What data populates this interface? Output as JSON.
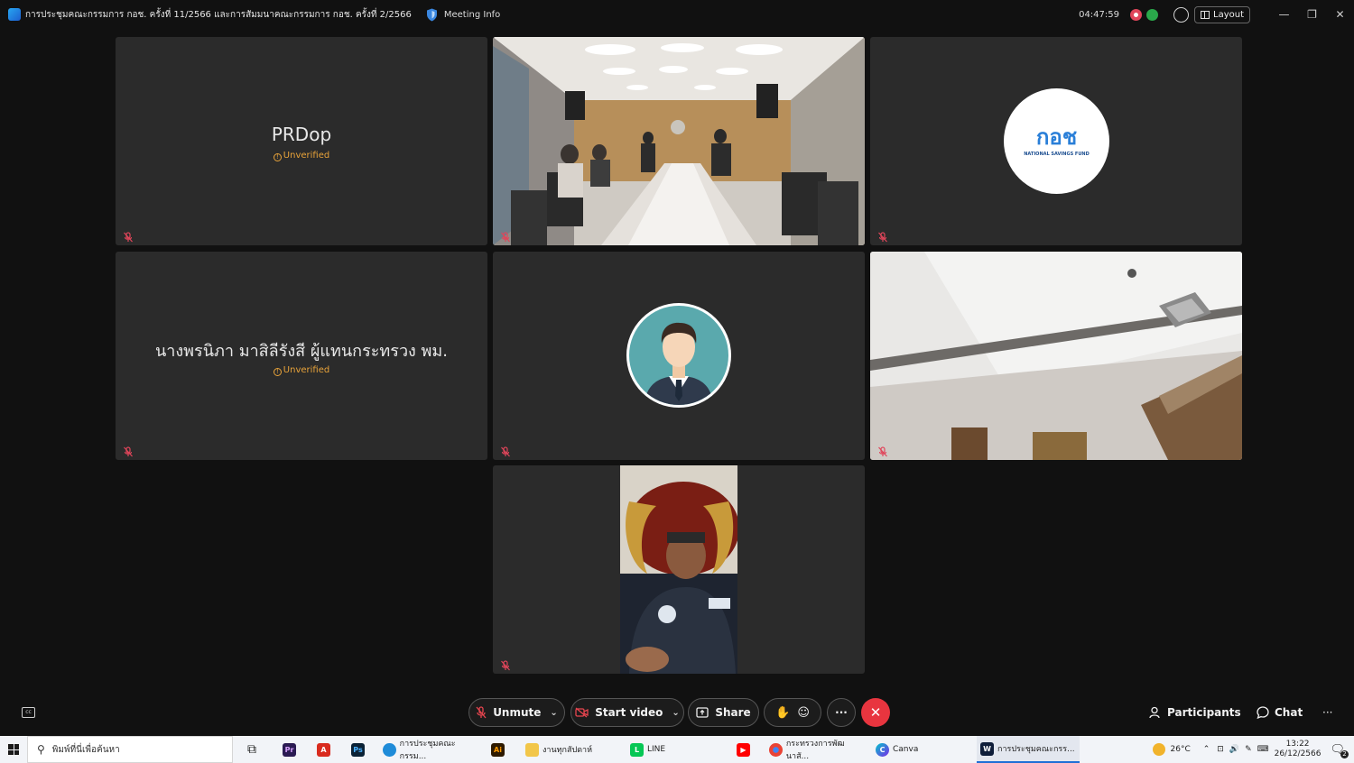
{
  "window": {
    "title": "การประชุมคณะกรรมการ กอช. ครั้งที่ 11/2566 และการสัมมนาคณะกรรมการ กอช. ครั้งที่ 2/2566",
    "meeting_info": "Meeting Info",
    "elapsed": "04:47:59",
    "layout_label": "Layout"
  },
  "tiles": {
    "t1": {
      "name": "PRDop",
      "status": "Unverified"
    },
    "t3": {
      "logo_text": "กอช",
      "logo_sub": "NATIONAL SAVINGS FUND"
    },
    "t4": {
      "name": "นางพรนิภา มาสิลีรังสี ผู้แทนกระทรวง พม.",
      "status": "Unverified"
    }
  },
  "controls": {
    "unmute": "Unmute",
    "start_video": "Start video",
    "share": "Share",
    "more": "···",
    "participants": "Participants",
    "chat": "Chat",
    "overflow": "···"
  },
  "taskbar": {
    "search_placeholder": "พิมพ์ที่นี่เพื่อค้นหา",
    "apps": [
      {
        "label": "การประชุมคณะกรรม...",
        "icon": "edge-icon"
      },
      {
        "label": "งานทุกสัปดาห์",
        "icon": "folder-icon"
      },
      {
        "label": "LINE",
        "icon": "line-icon"
      },
      {
        "label": "กระทรวงการพัฒนาสั...",
        "icon": "chrome-icon"
      },
      {
        "label": "Canva",
        "icon": "canva-icon"
      },
      {
        "label": "การประชุมคณะกรร...",
        "icon": "webex-icon"
      }
    ],
    "weather": "26°C",
    "time": "13:22",
    "date": "26/12/2566",
    "notifications": "2"
  },
  "colors": {
    "unverified": "#e8a33a",
    "leave": "#e8353f",
    "mute": "#e0455a"
  }
}
